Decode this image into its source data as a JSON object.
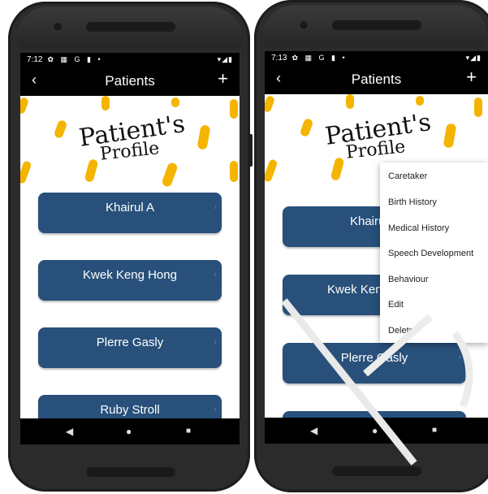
{
  "left_phone": {
    "status": {
      "time": "7:12",
      "icons": "✿ ▦ G ▮ •",
      "right": "▾◢▮"
    },
    "appbar": {
      "back": "‹",
      "title": "Patients",
      "add": "+"
    },
    "hero": {
      "line1": "Patient's",
      "line2": "Profile"
    },
    "patients": [
      "Khairul A",
      "Kwek Keng Hong",
      "Plerre Gasly",
      "Ruby Stroll"
    ],
    "arrow": "›",
    "nav": {
      "back": "◀",
      "home": "●",
      "recents": "■"
    }
  },
  "right_phone": {
    "status": {
      "time": "7:13",
      "icons": "✿ ▦ G ▮ •",
      "right": "▾◢▮"
    },
    "appbar": {
      "back": "‹",
      "title": "Patients",
      "add": "+"
    },
    "hero": {
      "line1": "Patient's",
      "line2": "Profile"
    },
    "patients": [
      "Khairul A",
      "Kwek Keng Hong",
      "Plerre Gasly",
      ""
    ],
    "visible_patients": [
      "Khai",
      "Kwek Ken",
      "Plerre Gasly"
    ],
    "arrow": "›",
    "menu": [
      "Caretaker",
      "Birth History",
      "Medical History",
      "Speech Development",
      "Behaviour",
      "Edit",
      "Delete"
    ],
    "nav": {
      "back": "◀",
      "home": "●",
      "recents": "■"
    }
  },
  "colors": {
    "accent": "#28507a",
    "dash": "#f4b400",
    "bar": "#000000",
    "bezel": "#2b2b2b"
  }
}
